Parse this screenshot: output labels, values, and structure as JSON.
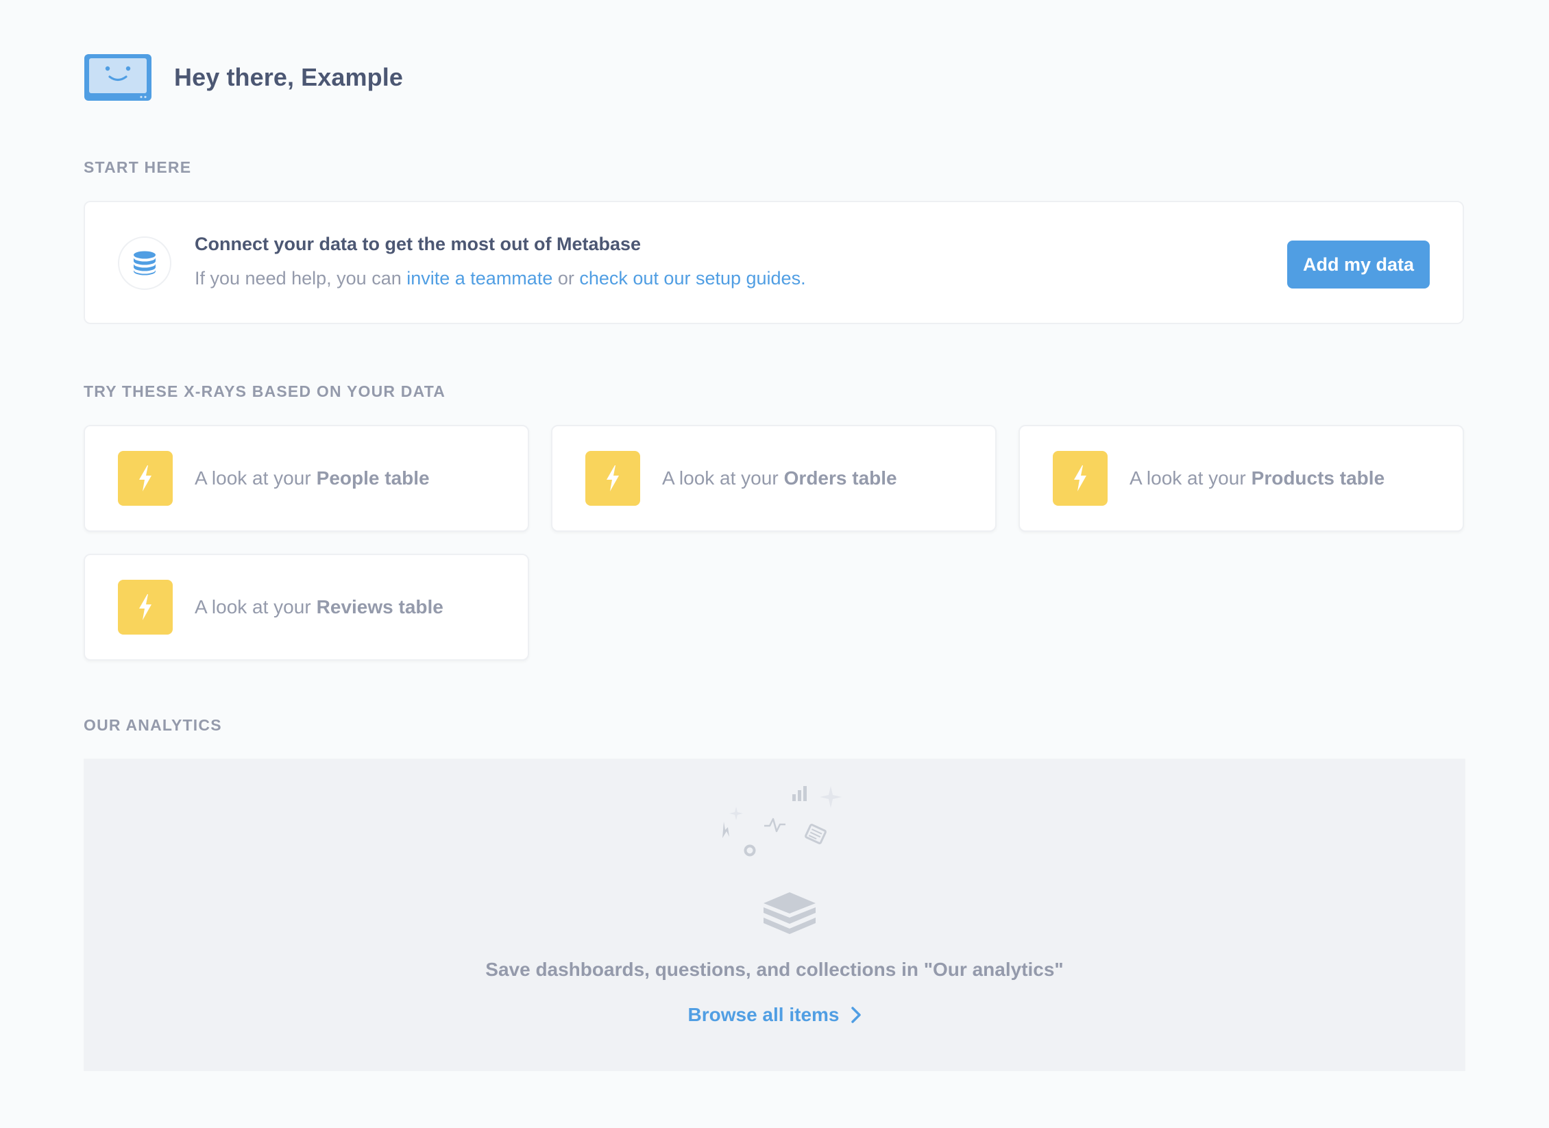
{
  "greeting": {
    "text": "Hey there, Example",
    "mascot_icon": "smiling-screen-icon"
  },
  "sections": {
    "start_here": "START HERE",
    "xrays": "TRY THESE X-RAYS BASED ON YOUR DATA",
    "our_analytics": "OUR ANALYTICS"
  },
  "start_card": {
    "icon": "database-icon",
    "title": "Connect your data to get the most out of Metabase",
    "desc_prefix": "If you need help, you can ",
    "link_invite": "invite a teammate",
    "desc_mid": " or ",
    "link_guides": "check out our setup guides",
    "desc_suffix": ".",
    "button_label": "Add my data"
  },
  "xrays": [
    {
      "prefix": "A look at your",
      "table": "People table",
      "icon": "bolt-icon"
    },
    {
      "prefix": "A look at your",
      "table": "Orders table",
      "icon": "bolt-icon"
    },
    {
      "prefix": "A look at your",
      "table": "Products table",
      "icon": "bolt-icon"
    },
    {
      "prefix": "A look at your",
      "table": "Reviews table",
      "icon": "bolt-icon"
    }
  ],
  "analytics": {
    "empty_text": "Save dashboards, questions, and collections in \"Our analytics\"",
    "browse_label": "Browse all items",
    "illustration_icon": "empty-collection-icon"
  },
  "colors": {
    "brand": "#509ee3",
    "xray_yellow": "#f9d45c",
    "text_dark": "#4c5773",
    "text_light": "#949aab",
    "background": "#f9fbfc",
    "empty_bg": "#f0f2f5"
  }
}
